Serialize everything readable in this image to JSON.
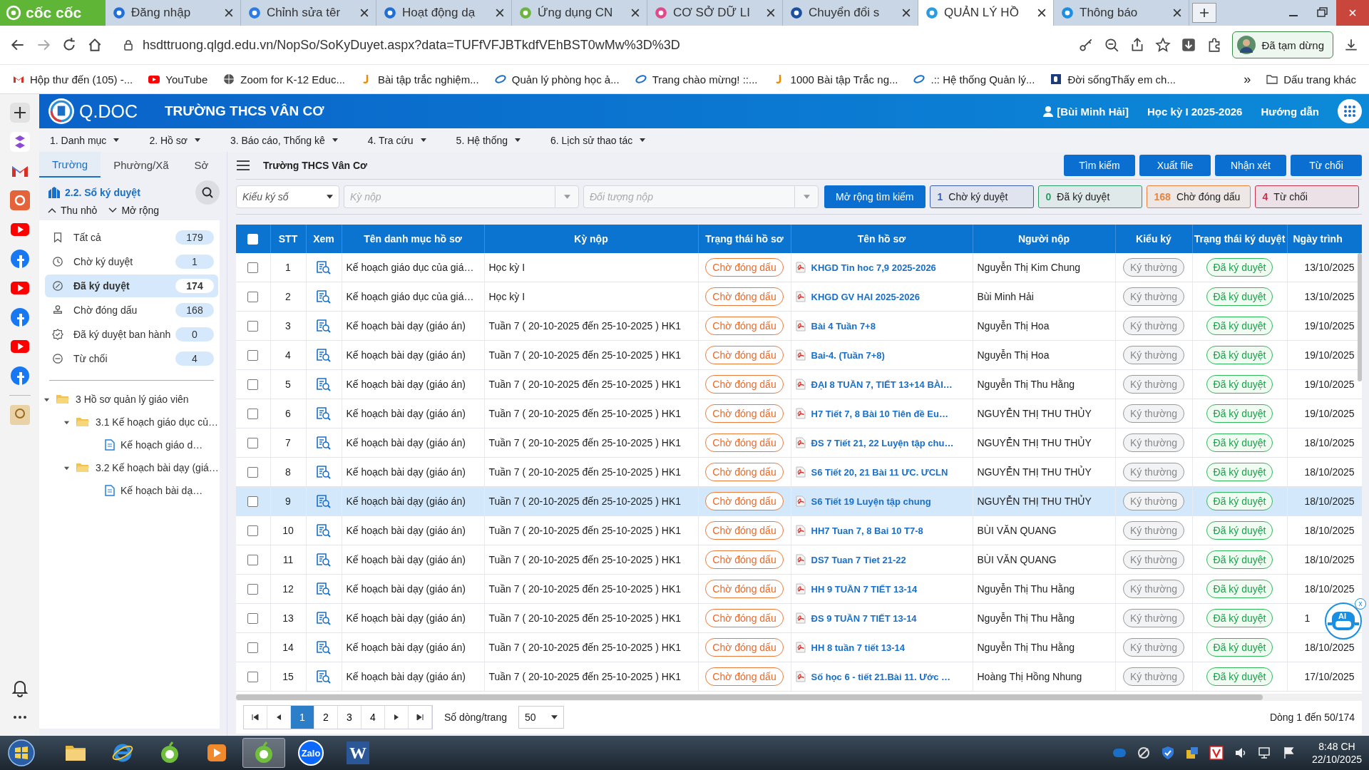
{
  "browser": {
    "logo": "cốc cốc",
    "tabs": [
      {
        "title": "Đăng nhập",
        "selected": false
      },
      {
        "title": "Chỉnh sửa têr",
        "selected": false
      },
      {
        "title": "Hoạt động dạ",
        "selected": false
      },
      {
        "title": "Ứng dụng CN",
        "selected": false
      },
      {
        "title": "CƠ SỞ DỮ LI",
        "selected": false
      },
      {
        "title": "Chuyển đổi s",
        "selected": false
      },
      {
        "title": "QUẢN LÝ HỒ",
        "selected": true
      },
      {
        "title": "Thông báo",
        "selected": false
      }
    ],
    "address": "hsdttruong.qlgd.edu.vn/NopSo/SoKyDuyet.aspx?data=TUFfVFJBTkdfVEhBST0wMw%3D%3D",
    "profile": "Đã tạm dừng",
    "bookmarks": [
      {
        "label": "Hộp thư đến (105) -...",
        "kind": "mail"
      },
      {
        "label": "YouTube",
        "kind": "video"
      },
      {
        "label": "Zoom for K-12 Educ...",
        "kind": "globe"
      },
      {
        "label": "Bài tập trắc nghiệm...",
        "kind": "j"
      },
      {
        "label": "Quản lý phòng học ả...",
        "kind": "e"
      },
      {
        "label": "Trang chào mừng! ::...",
        "kind": "e"
      },
      {
        "label": "1000 Bài tập Trắc ng...",
        "kind": "j"
      },
      {
        "label": ".:: Hệ thống Quản lý...",
        "kind": "e"
      },
      {
        "label": "Đời sốngThấy em ch...",
        "kind": "d"
      }
    ],
    "more": "»",
    "other_bookmarks": "Dấu trang khác"
  },
  "header": {
    "logo": "Q.DOC",
    "school": "TRƯỜNG THCS VÂN CƠ",
    "user": "[Bùi Minh Hải]",
    "term": "Học kỳ I 2025-2026",
    "help": "Hướng dẫn"
  },
  "menu": [
    "1. Danh mục",
    "2. Hồ sơ",
    "3. Báo cáo, Thống kê",
    "4. Tra cứu",
    "5. Hệ thống",
    "6. Lịch sử thao tác"
  ],
  "panel": {
    "tabs": [
      {
        "label": "Trường",
        "selected": true
      },
      {
        "label": "Phường/Xã",
        "selected": false
      },
      {
        "label": "Sở",
        "selected": false
      }
    ],
    "title": "2.2. Sổ ký duyệt",
    "collapse": "Thu nhỏ",
    "expand": "Mở rộng",
    "statuses": [
      {
        "kind": "all",
        "label": "Tất cả",
        "count": "179",
        "selected": false
      },
      {
        "kind": "pending",
        "label": "Chờ ký duyệt",
        "count": "1",
        "selected": false
      },
      {
        "kind": "approved",
        "label": "Đã ký duyệt",
        "count": "174",
        "selected": true
      },
      {
        "kind": "stamp",
        "label": "Chờ đóng dấu",
        "count": "168",
        "selected": false
      },
      {
        "kind": "issued",
        "label": "Đã ký duyệt ban hành",
        "count": "0",
        "selected": false
      },
      {
        "kind": "rejected",
        "label": "Từ chối",
        "count": "4",
        "selected": false
      }
    ],
    "tree": [
      {
        "kind": "folder",
        "label": "3 Hồ sơ quản lý giáo viên",
        "expanded": true,
        "children": [
          {
            "kind": "folder",
            "label": "3.1 Kế hoạch giáo dục củ…",
            "expanded": true,
            "children": [
              {
                "kind": "file",
                "label": "Kế hoạch giáo d…"
              }
            ]
          },
          {
            "kind": "folder",
            "label": "3.2 Kế hoạch bài dạy (giá…",
            "expanded": true,
            "children": [
              {
                "kind": "file",
                "label": "Kế hoạch bài dạ…"
              }
            ]
          }
        ]
      }
    ]
  },
  "main": {
    "title": "Trường THCS Vân Cơ",
    "actions": [
      "Tìm kiếm",
      "Xuất file",
      "Nhận xét",
      "Từ chối"
    ],
    "filters": {
      "sign_type": "Kiểu ký số",
      "period_placeholder": "Kỳ nộp",
      "target_placeholder": "Đối tượng nộp",
      "expand_search": "Mở rộng tìm kiếm"
    },
    "counters": [
      {
        "count": "1",
        "label": "Chờ ký duyệt",
        "color": "#3b5fb0"
      },
      {
        "count": "0",
        "label": "Đã ký duyệt",
        "color": "#2e9a6a"
      },
      {
        "count": "168",
        "label": "Chờ đóng dấu",
        "color": "#e8843c"
      },
      {
        "count": "4",
        "label": "Từ chối",
        "color": "#c8324a"
      }
    ]
  },
  "table": {
    "select_all": false,
    "columns": [
      "STT",
      "Xem",
      "Tên danh mục hồ sơ",
      "Kỳ nộp",
      "Trạng thái hồ sơ",
      "Tên hồ sơ",
      "Người nộp",
      "Kiểu ký",
      "Trạng thái ký duyệt",
      "Ngày trình"
    ],
    "rows": [
      {
        "stt": "1",
        "category": "Kế hoạch giáo dục của giá…",
        "period": "Học kỳ I",
        "status": "Chờ đóng dấu",
        "file": "KHGD Tin hoc 7,9 2025-2026",
        "submitter": "Nguyễn Thị Kim Chung",
        "sign": "Ký thường",
        "sign_status": "Đã ký duyệt",
        "date": "13/10/2025",
        "checked": false,
        "selected": false
      },
      {
        "stt": "2",
        "category": "Kế hoạch giáo dục của giá…",
        "period": "Học kỳ I",
        "status": "Chờ đóng dấu",
        "file": "KHGD GV HAI 2025-2026",
        "submitter": "Bùi Minh Hải",
        "sign": "Ký thường",
        "sign_status": "Đã ký duyệt",
        "date": "13/10/2025",
        "checked": false,
        "selected": false
      },
      {
        "stt": "3",
        "category": "Kế hoạch bài dạy (giáo án)",
        "period": "Tuần 7 ( 20-10-2025 đến 25-10-2025 ) HK1",
        "status": "Chờ đóng dấu",
        "file": "Bài 4 Tuần 7+8",
        "submitter": "Nguyễn Thị Hoa",
        "sign": "Ký thường",
        "sign_status": "Đã ký duyệt",
        "date": "19/10/2025",
        "checked": false,
        "selected": false
      },
      {
        "stt": "4",
        "category": "Kế hoạch bài dạy (giáo án)",
        "period": "Tuần 7 ( 20-10-2025 đến 25-10-2025 ) HK1",
        "status": "Chờ đóng dấu",
        "file": "Bai-4. (Tuần 7+8)",
        "submitter": "Nguyễn Thị Hoa",
        "sign": "Ký thường",
        "sign_status": "Đã ký duyệt",
        "date": "19/10/2025",
        "checked": false,
        "selected": false
      },
      {
        "stt": "5",
        "category": "Kế hoạch bài dạy (giáo án)",
        "period": "Tuần 7 ( 20-10-2025 đến 25-10-2025 ) HK1",
        "status": "Chờ đóng dấu",
        "file": "ĐẠI 8 TUẦN 7, TIẾT 13+14 BÀI…",
        "submitter": "Nguyễn Thị Thu Hằng",
        "sign": "Ký thường",
        "sign_status": "Đã ký duyệt",
        "date": "19/10/2025",
        "checked": false,
        "selected": false
      },
      {
        "stt": "6",
        "category": "Kế hoạch bài dạy (giáo án)",
        "period": "Tuần 7 ( 20-10-2025 đến 25-10-2025 ) HK1",
        "status": "Chờ đóng dấu",
        "file": "H7 Tiết 7, 8 Bài 10 Tiên đề Eu…",
        "submitter": "NGUYỄN THỊ THU THỦY",
        "sign": "Ký thường",
        "sign_status": "Đã ký duyệt",
        "date": "19/10/2025",
        "checked": false,
        "selected": false
      },
      {
        "stt": "7",
        "category": "Kế hoạch bài dạy (giáo án)",
        "period": "Tuần 7 ( 20-10-2025 đến 25-10-2025 ) HK1",
        "status": "Chờ đóng dấu",
        "file": "ĐS 7 Tiết 21, 22 Luyện tập chu…",
        "submitter": "NGUYỄN THỊ THU THỦY",
        "sign": "Ký thường",
        "sign_status": "Đã ký duyệt",
        "date": "18/10/2025",
        "checked": false,
        "selected": false
      },
      {
        "stt": "8",
        "category": "Kế hoạch bài dạy (giáo án)",
        "period": "Tuần 7 ( 20-10-2025 đến 25-10-2025 ) HK1",
        "status": "Chờ đóng dấu",
        "file": "S6 Tiết 20, 21 Bài 11 ƯC. ƯCLN",
        "submitter": "NGUYỄN THỊ THU THỦY",
        "sign": "Ký thường",
        "sign_status": "Đã ký duyệt",
        "date": "18/10/2025",
        "checked": false,
        "selected": false
      },
      {
        "stt": "9",
        "category": "Kế hoạch bài dạy (giáo án)",
        "period": "Tuần 7 ( 20-10-2025 đến 25-10-2025 ) HK1",
        "status": "Chờ đóng dấu",
        "file": "S6 Tiết 19 Luyện tập chung",
        "submitter": "NGUYỄN THỊ THU THỦY",
        "sign": "Ký thường",
        "sign_status": "Đã ký duyệt",
        "date": "18/10/2025",
        "checked": false,
        "selected": true
      },
      {
        "stt": "10",
        "category": "Kế hoạch bài dạy (giáo án)",
        "period": "Tuần 7 ( 20-10-2025 đến 25-10-2025 ) HK1",
        "status": "Chờ đóng dấu",
        "file": "HH7 Tuan 7, 8 Bai 10 T7-8",
        "submitter": "BÙI VĂN QUANG",
        "sign": "Ký thường",
        "sign_status": "Đã ký duyệt",
        "date": "18/10/2025",
        "checked": false,
        "selected": false
      },
      {
        "stt": "11",
        "category": "Kế hoạch bài dạy (giáo án)",
        "period": "Tuần 7 ( 20-10-2025 đến 25-10-2025 ) HK1",
        "status": "Chờ đóng dấu",
        "file": "DS7 Tuan 7 Tiet 21-22",
        "submitter": "BÙI VĂN QUANG",
        "sign": "Ký thường",
        "sign_status": "Đã ký duyệt",
        "date": "18/10/2025",
        "checked": false,
        "selected": false
      },
      {
        "stt": "12",
        "category": "Kế hoạch bài dạy (giáo án)",
        "period": "Tuần 7 ( 20-10-2025 đến 25-10-2025 ) HK1",
        "status": "Chờ đóng dấu",
        "file": "HH 9 TUẦN 7 TIẾT 13-14",
        "submitter": "Nguyễn Thị Thu Hằng",
        "sign": "Ký thường",
        "sign_status": "Đã ký duyệt",
        "date": "18/10/2025",
        "checked": false,
        "selected": false
      },
      {
        "stt": "13",
        "category": "Kế hoạch bài dạy (giáo án)",
        "period": "Tuần 7 ( 20-10-2025 đến 25-10-2025 ) HK1",
        "status": "Chờ đóng dấu",
        "file": "ĐS 9 TUẦN 7 TIẾT 13-14",
        "submitter": "Nguyễn Thị Thu Hằng",
        "sign": "Ký thường",
        "sign_status": "Đã ký duyệt",
        "date": "1",
        "checked": false,
        "selected": false
      },
      {
        "stt": "14",
        "category": "Kế hoạch bài dạy (giáo án)",
        "period": "Tuần 7 ( 20-10-2025 đến 25-10-2025 ) HK1",
        "status": "Chờ đóng dấu",
        "file": "HH 8 tuần 7 tiết 13-14",
        "submitter": "Nguyễn Thị Thu Hằng",
        "sign": "Ký thường",
        "sign_status": "Đã ký duyệt",
        "date": "18/10/2025",
        "checked": false,
        "selected": false
      },
      {
        "stt": "15",
        "category": "Kế hoạch bài dạy (giáo án)",
        "period": "Tuần 7 ( 20-10-2025 đến 25-10-2025 ) HK1",
        "status": "Chờ đóng dấu",
        "file": "Số học 6 - tiết 21.Bài 11. Ước …",
        "submitter": "Hoàng Thị Hồng Nhung",
        "sign": "Ký thường",
        "sign_status": "Đã ký duyệt",
        "date": "17/10/2025",
        "checked": false,
        "selected": false
      }
    ]
  },
  "pagination": {
    "pages": [
      {
        "label": "1",
        "selected": true
      },
      {
        "label": "2",
        "selected": false
      },
      {
        "label": "3",
        "selected": false
      },
      {
        "label": "4",
        "selected": false
      }
    ],
    "page_size_label": "Số dòng/trang",
    "page_size": "50",
    "summary": "Dòng 1 đến 50/174"
  },
  "assistant": {
    "label": "AI",
    "close": "x"
  },
  "taskbar": {
    "apps": [
      {
        "kind": "folder",
        "selected": false
      },
      {
        "kind": "ie",
        "selected": false
      },
      {
        "kind": "coccoc",
        "selected": false
      },
      {
        "kind": "media",
        "selected": false
      },
      {
        "kind": "coccoc",
        "selected": true
      },
      {
        "kind": "zalo",
        "label": "Zalo",
        "selected": false
      },
      {
        "kind": "word",
        "label": "W",
        "selected": false
      }
    ],
    "time": "8:48 CH",
    "date": "22/10/2025"
  }
}
